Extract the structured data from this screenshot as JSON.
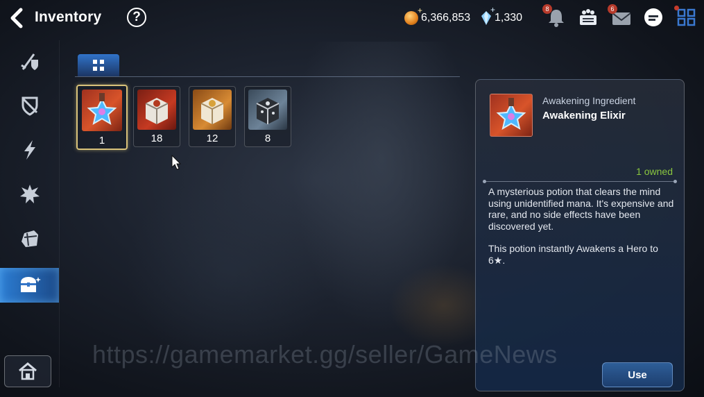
{
  "header": {
    "title": "Inventory",
    "help_label": "?",
    "gold_value": "6,366,853",
    "crystal_value": "1,330",
    "notification_badge": "8",
    "mail_badge": "6"
  },
  "sidebar": {
    "items": [
      {
        "icon": "weapon-armor-icon"
      },
      {
        "icon": "accessory-icon"
      },
      {
        "icon": "artifact-icon"
      },
      {
        "icon": "catalyst-icon"
      },
      {
        "icon": "material-icon"
      },
      {
        "icon": "chest-icon",
        "active": true
      }
    ],
    "home_icon": "home-icon"
  },
  "filter": {
    "icon": "grid-icon"
  },
  "items": [
    {
      "name": "Awakening Elixir",
      "qty": "1",
      "art": "elixir"
    },
    {
      "name": "Red Box",
      "qty": "18",
      "art": "red-box"
    },
    {
      "name": "Gold Box",
      "qty": "12",
      "art": "gold-box"
    },
    {
      "name": "Dark Box",
      "qty": "8",
      "art": "dark-box"
    }
  ],
  "detail": {
    "category": "Awakening Ingredient",
    "name": "Awakening Elixir",
    "owned": "1 owned",
    "desc1": "A mysterious potion that clears the mind using unidentified mana. It's expensive and rare, and no side effects have been discovered yet.",
    "desc2": "This potion instantly Awakens a Hero to 6★.",
    "use_label": "Use"
  },
  "watermark": "https://gamemarket.gg/seller/GameNews",
  "colors": {
    "accent": "#2e7fd6",
    "owned": "#8ac73f",
    "selected_border": "#d9c27a"
  }
}
